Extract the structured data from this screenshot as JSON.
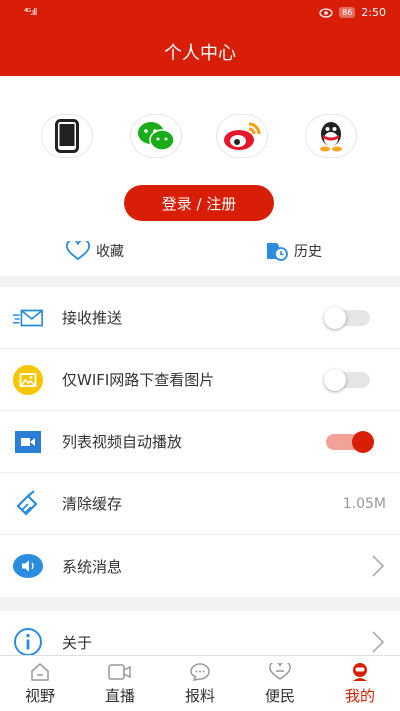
{
  "status_bar": {
    "signal": "⁴ᴳ.ıll",
    "battery": "86",
    "time": "2:50"
  },
  "header": {
    "title": "个人中心"
  },
  "login": {
    "button_label": "登录 / 注册",
    "social": [
      "phone-icon",
      "wechat-icon",
      "weibo-icon",
      "qq-icon"
    ]
  },
  "quick_links": {
    "favorites": "收藏",
    "history": "历史"
  },
  "settings": {
    "push": {
      "label": "接收推送",
      "enabled": false
    },
    "wifi_images": {
      "label": "仅WIFI网路下查看图片",
      "enabled": false
    },
    "autoplay": {
      "label": "列表视频自动播放",
      "enabled": true
    },
    "cache": {
      "label": "清除缓存",
      "value": "1.05M"
    },
    "messages": {
      "label": "系统消息"
    },
    "about": {
      "label": "关于"
    }
  },
  "nav": {
    "items": [
      {
        "label": "视野",
        "icon": "home-icon"
      },
      {
        "label": "直播",
        "icon": "video-icon"
      },
      {
        "label": "报料",
        "icon": "chat-icon"
      },
      {
        "label": "便民",
        "icon": "heart-icon"
      },
      {
        "label": "我的",
        "icon": "user-icon"
      }
    ]
  },
  "colors": {
    "accent": "#d81e06",
    "toggle_on_track": "#f1a39a"
  }
}
